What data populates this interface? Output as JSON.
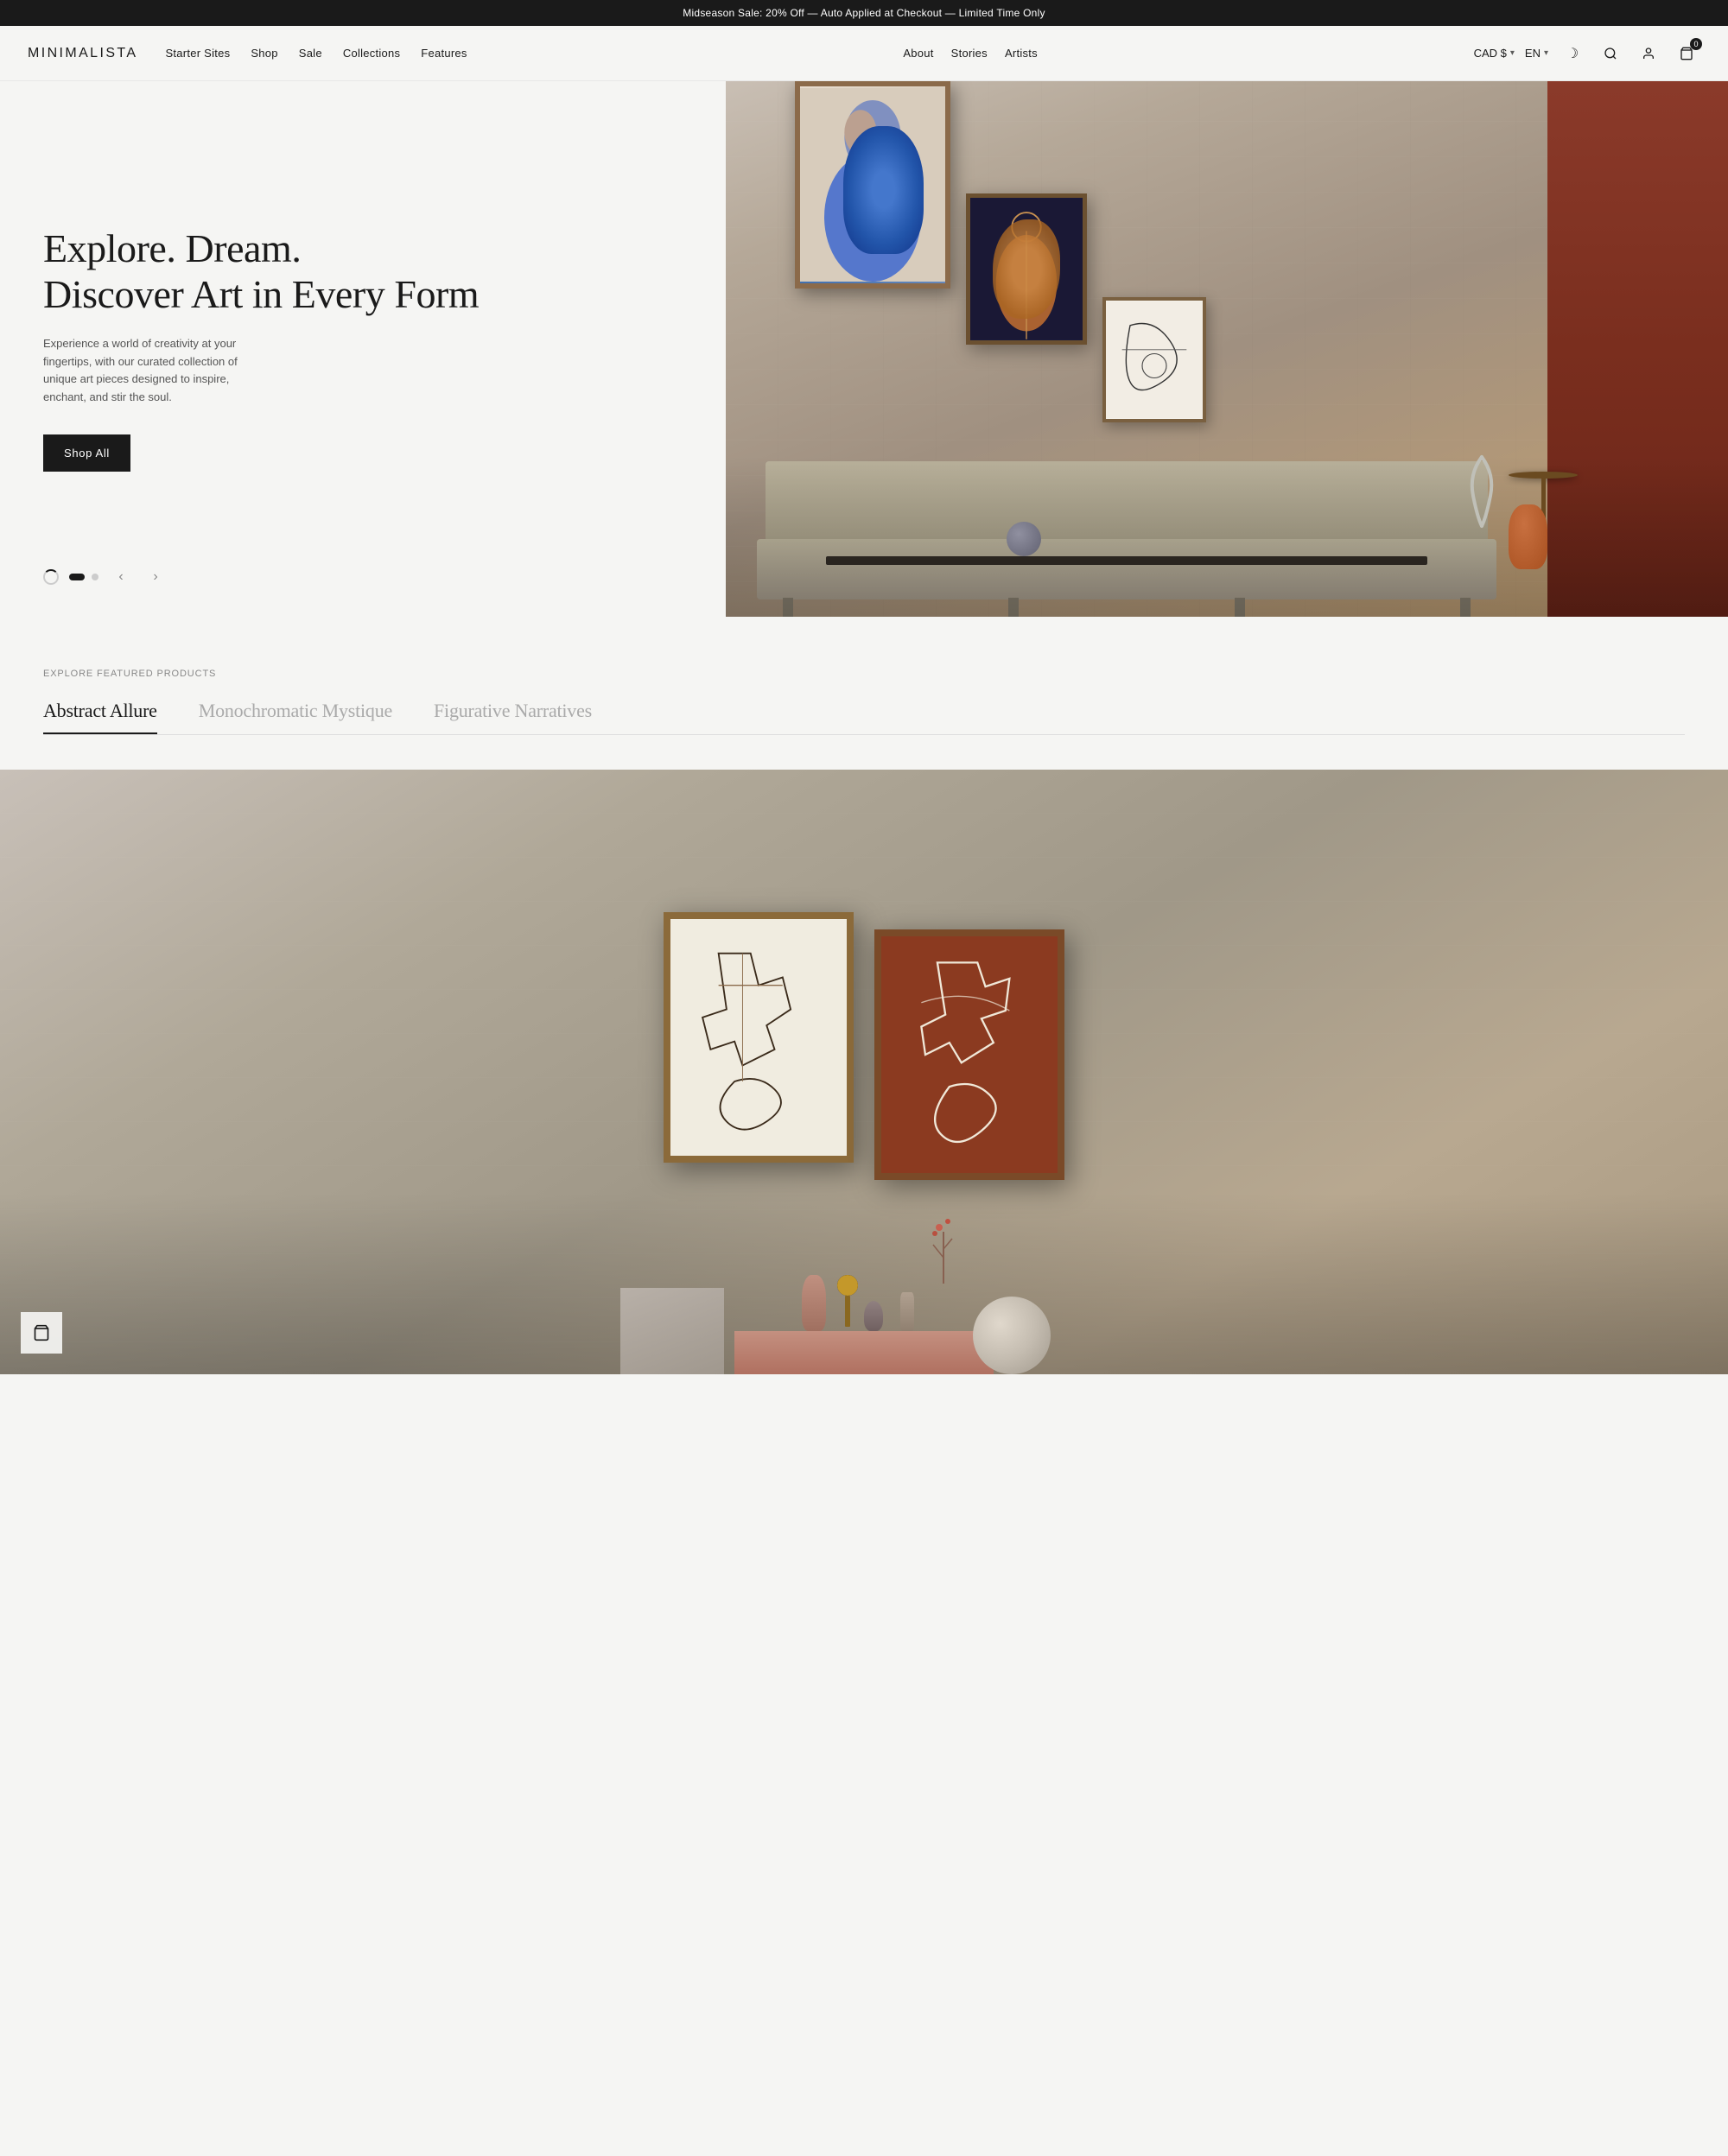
{
  "announcement": {
    "text": "Midseason Sale: 20% Off — Auto Applied at Checkout — Limited Time Only"
  },
  "header": {
    "logo": "MINIMALISTA",
    "nav_primary": [
      {
        "label": "Starter Sites",
        "href": "#"
      },
      {
        "label": "Shop",
        "href": "#"
      },
      {
        "label": "Sale",
        "href": "#"
      },
      {
        "label": "Collections",
        "href": "#"
      },
      {
        "label": "Features",
        "href": "#"
      }
    ],
    "nav_secondary": [
      {
        "label": "About",
        "href": "#"
      },
      {
        "label": "Stories",
        "href": "#"
      },
      {
        "label": "Artists",
        "href": "#"
      }
    ],
    "currency": "CAD $",
    "currency_chevron": "▾",
    "language": "EN",
    "language_chevron": "▾",
    "cart_count": "0"
  },
  "hero": {
    "heading_line1": "Explore. Dream.",
    "heading_line2": "Discover Art in Every Form",
    "description": "Experience a world of creativity at your fingertips, with our curated collection of unique art pieces designed to inspire, enchant, and stir the soul.",
    "cta_label": "Shop All",
    "slide_count": 2,
    "active_slide": 0
  },
  "featured": {
    "label": "Explore Featured Products",
    "tabs": [
      {
        "label": "Abstract Allure",
        "active": true
      },
      {
        "label": "Monochromatic Mystique",
        "active": false
      },
      {
        "label": "Figurative Narratives",
        "active": false
      }
    ]
  },
  "icons": {
    "moon": "☽",
    "search": "🔍",
    "user": "👤",
    "cart": "🛍",
    "cart_small": "🛒",
    "chevron_left": "‹",
    "chevron_right": "›"
  }
}
